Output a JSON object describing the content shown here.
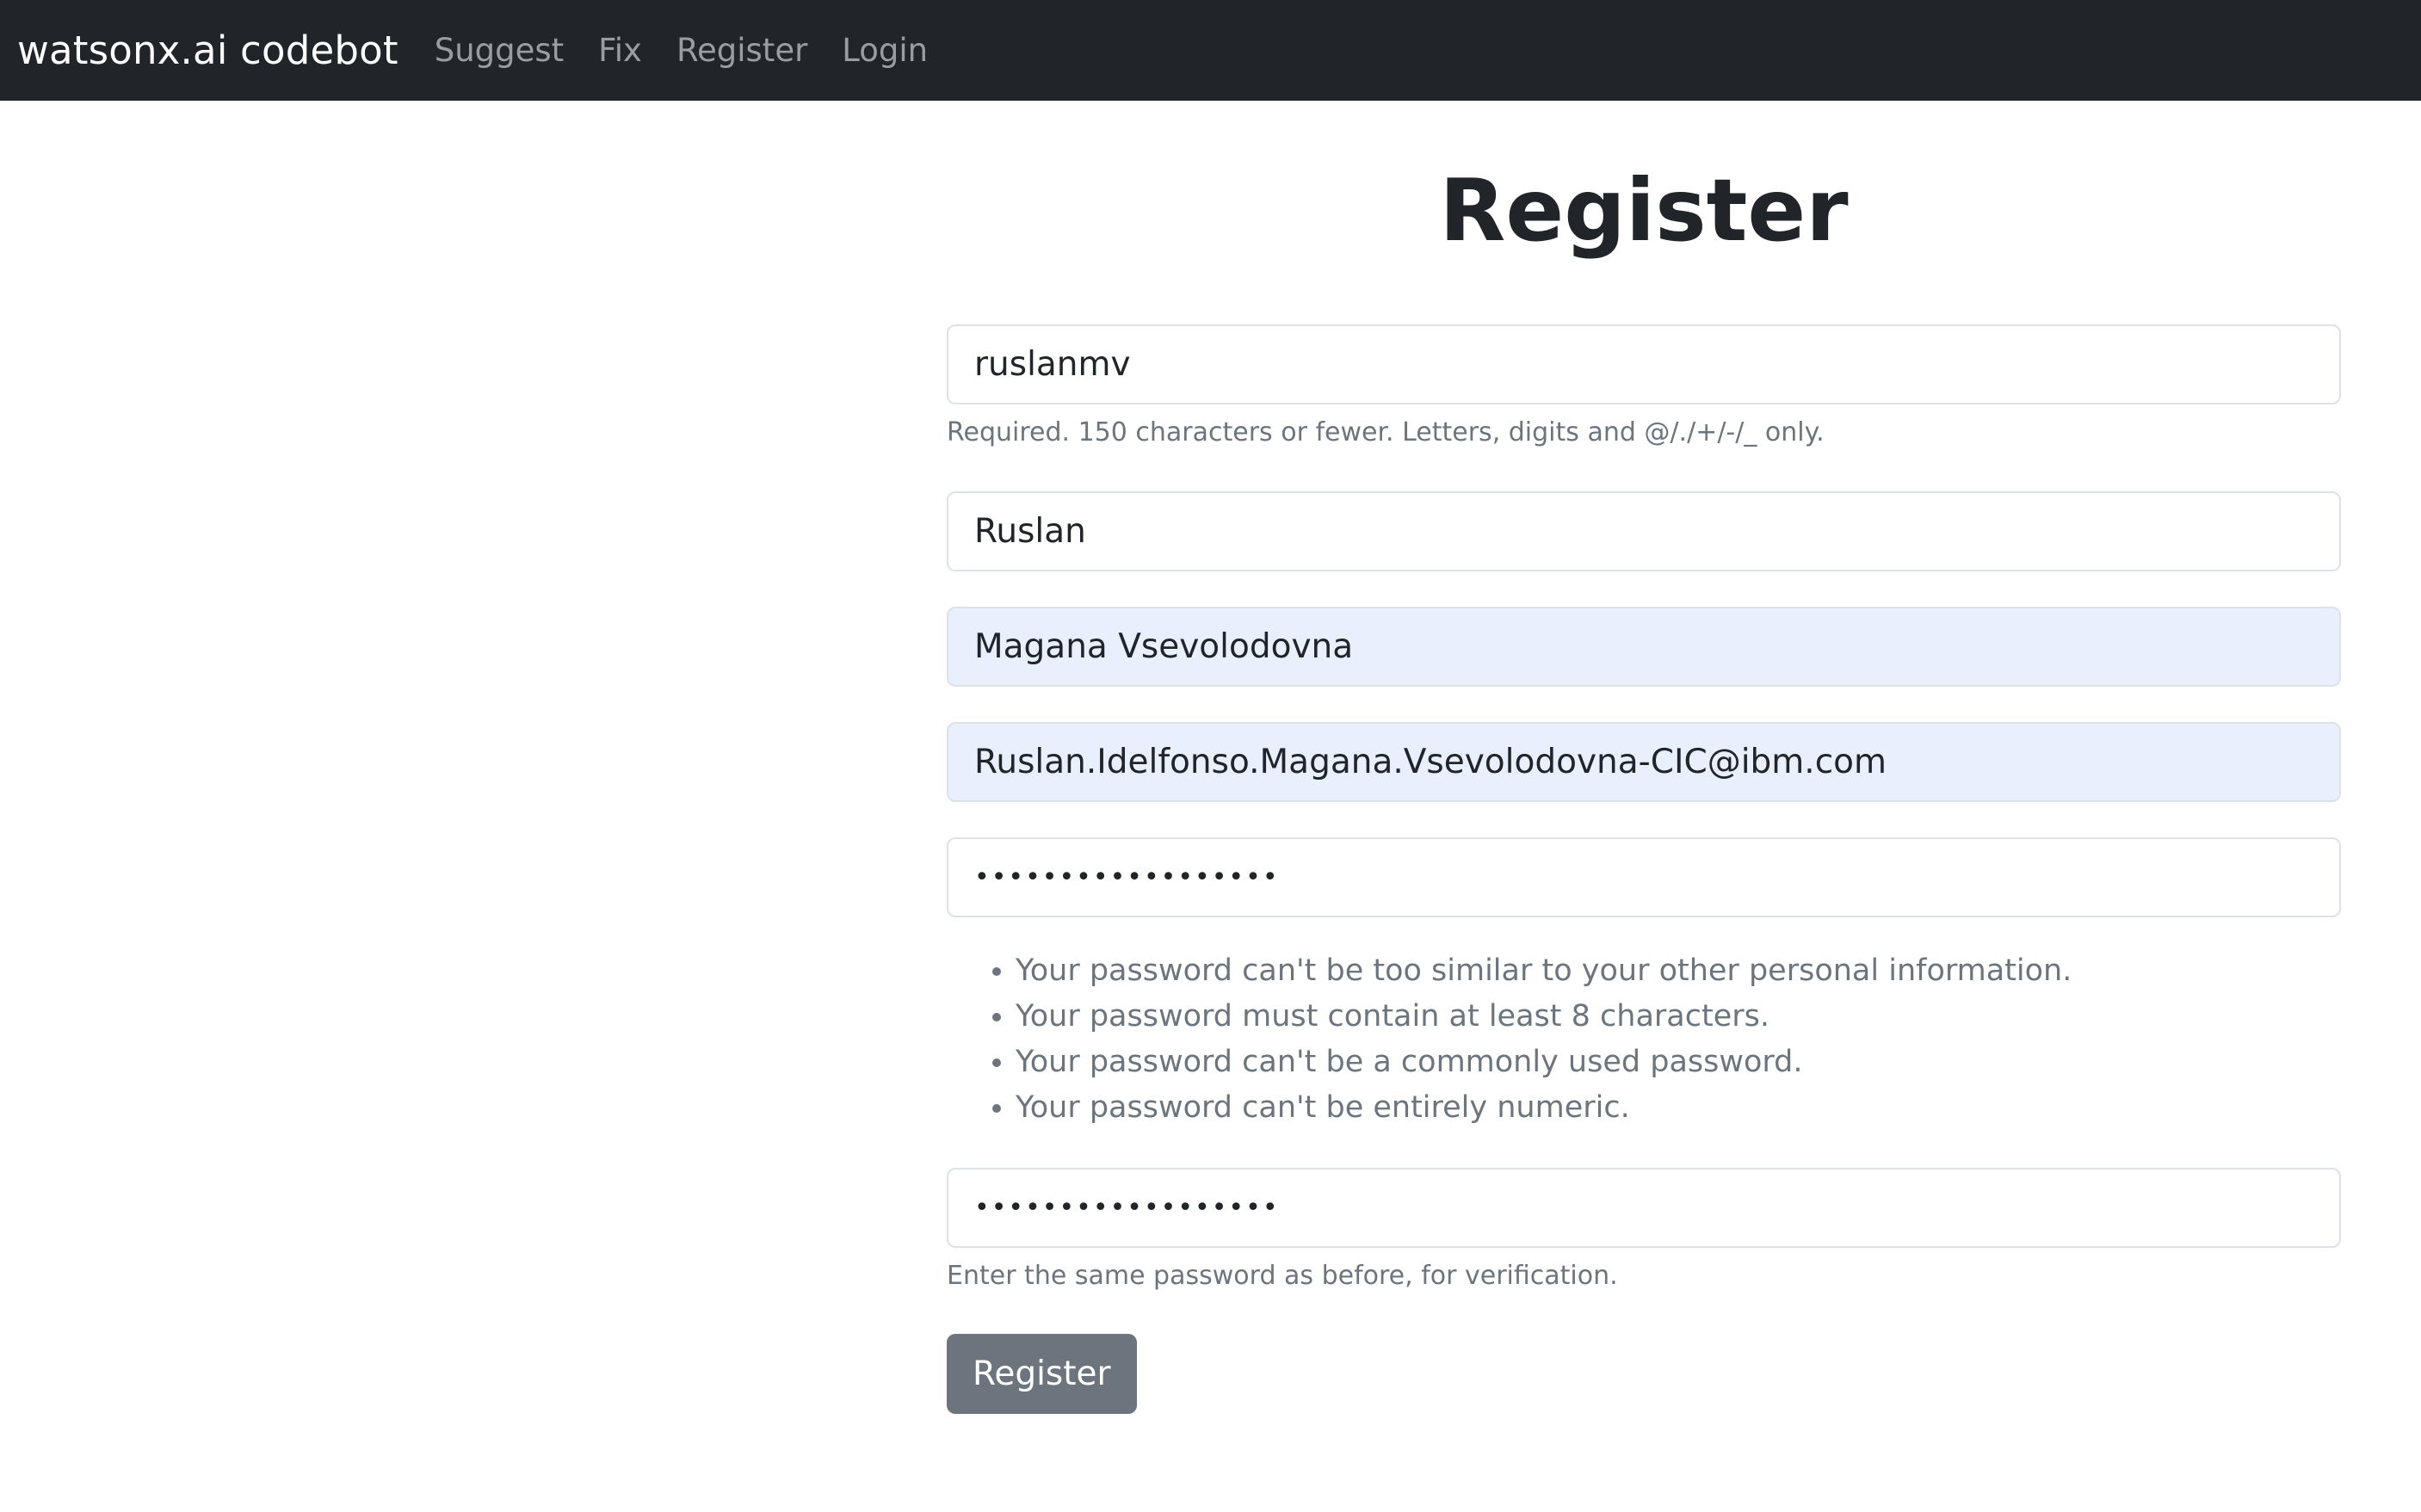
{
  "navbar": {
    "brand": "watsonx.ai codebot",
    "links": [
      "Suggest",
      "Fix",
      "Register",
      "Login"
    ]
  },
  "page": {
    "title": "Register"
  },
  "form": {
    "username": {
      "value": "ruslanmv",
      "help": "Required. 150 characters or fewer. Letters, digits and @/./+/-/_ only."
    },
    "first_name": {
      "value": "Ruslan"
    },
    "last_name": {
      "value": "Magana Vsevolodovna"
    },
    "email": {
      "value": "Ruslan.Idelfonso.Magana.Vsevolodovna-CIC@ibm.com"
    },
    "password1": {
      "value": "••••••••••••••••••",
      "rules": [
        "Your password can't be too similar to your other personal information.",
        "Your password must contain at least 8 characters.",
        "Your password can't be a commonly used password.",
        "Your password can't be entirely numeric."
      ]
    },
    "password2": {
      "value": "••••••••••••••••••",
      "help": "Enter the same password as before, for verification."
    },
    "submit_label": "Register"
  },
  "colors": {
    "navbar_bg": "#212529",
    "autofill_bg": "#e8f0fe",
    "button_bg": "#6c757d",
    "muted_text": "#6c757d"
  }
}
